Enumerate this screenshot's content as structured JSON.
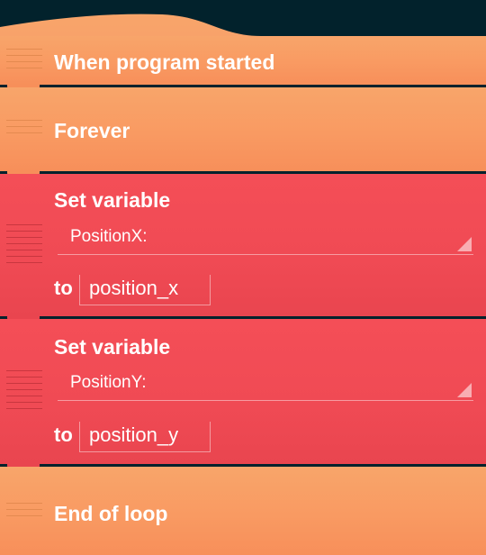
{
  "colors": {
    "background": "#02222c",
    "event_block": "#f99a62",
    "variable_block": "#f04a54",
    "text": "#ffffff"
  },
  "blocks": [
    {
      "type": "event",
      "label": "When program started"
    },
    {
      "type": "loop_start",
      "label": "Forever"
    },
    {
      "type": "set_variable",
      "label": "Set variable",
      "variable": "PositionX:",
      "to_label": "to",
      "value": "position_x"
    },
    {
      "type": "set_variable",
      "label": "Set variable",
      "variable": "PositionY:",
      "to_label": "to",
      "value": "position_y"
    },
    {
      "type": "loop_end",
      "label": "End of loop"
    }
  ],
  "icons": {
    "drag_handle": "drag-handle-icon",
    "dropdown_arrow": "dropdown-arrow-icon"
  }
}
